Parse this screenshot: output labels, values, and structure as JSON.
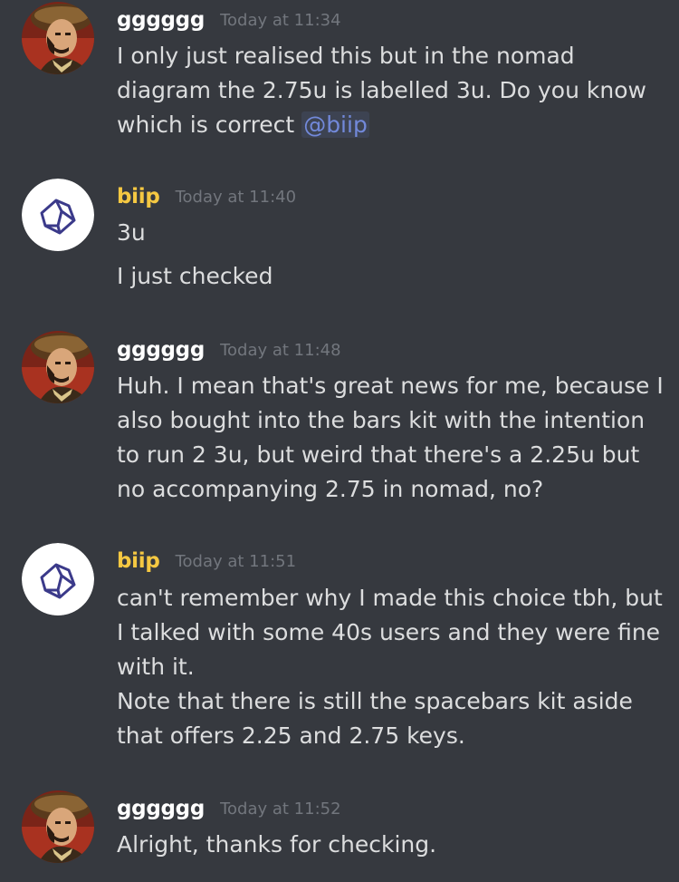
{
  "colors": {
    "background": "#36393f",
    "message_text": "#dcddde",
    "timestamp": "#72767d",
    "user_gggggg": "#ffffff",
    "user_biip": "#f5c842",
    "mention_text": "#7289da"
  },
  "messages": [
    {
      "author": "gggggg",
      "timestamp": "Today at 11:34",
      "avatar_icon": "portrait-avatar-icon",
      "lines": [
        {
          "text": "I only just realised this but in the nomad"
        },
        {
          "text": "diagram the 2.75u is labelled 3u. Do you know"
        },
        {
          "text": "which is correct ",
          "mention": "@biip"
        }
      ]
    },
    {
      "author": "biip",
      "timestamp": "Today at 11:40",
      "avatar_icon": "keycap-logo-avatar-icon",
      "lines": [
        {
          "text": "3u"
        },
        {
          "text": "I just checked"
        }
      ]
    },
    {
      "author": "gggggg",
      "timestamp": "Today at 11:48",
      "avatar_icon": "portrait-avatar-icon",
      "lines": [
        {
          "text": "Huh. I mean that's great news for me, because I"
        },
        {
          "text": "also bought into the bars kit with the intention"
        },
        {
          "text": "to run 2 3u, but weird that there's a 2.25u but"
        },
        {
          "text": "no accompanying 2.75 in nomad, no?"
        }
      ]
    },
    {
      "author": "biip",
      "timestamp": "Today at 11:51",
      "avatar_icon": "keycap-logo-avatar-icon",
      "lines": [
        {
          "text": "can't remember why I made this choice tbh, but"
        },
        {
          "text": "I talked with some 40s users and they were fine"
        },
        {
          "text": "with it."
        },
        {
          "text": "Note that there is still the spacebars kit aside"
        },
        {
          "text": "that offers 2.25 and 2.75 keys."
        }
      ]
    },
    {
      "author": "gggggg",
      "timestamp": "Today at 11:52",
      "avatar_icon": "portrait-avatar-icon",
      "lines": [
        {
          "text": "Alright, thanks for checking."
        }
      ]
    }
  ]
}
